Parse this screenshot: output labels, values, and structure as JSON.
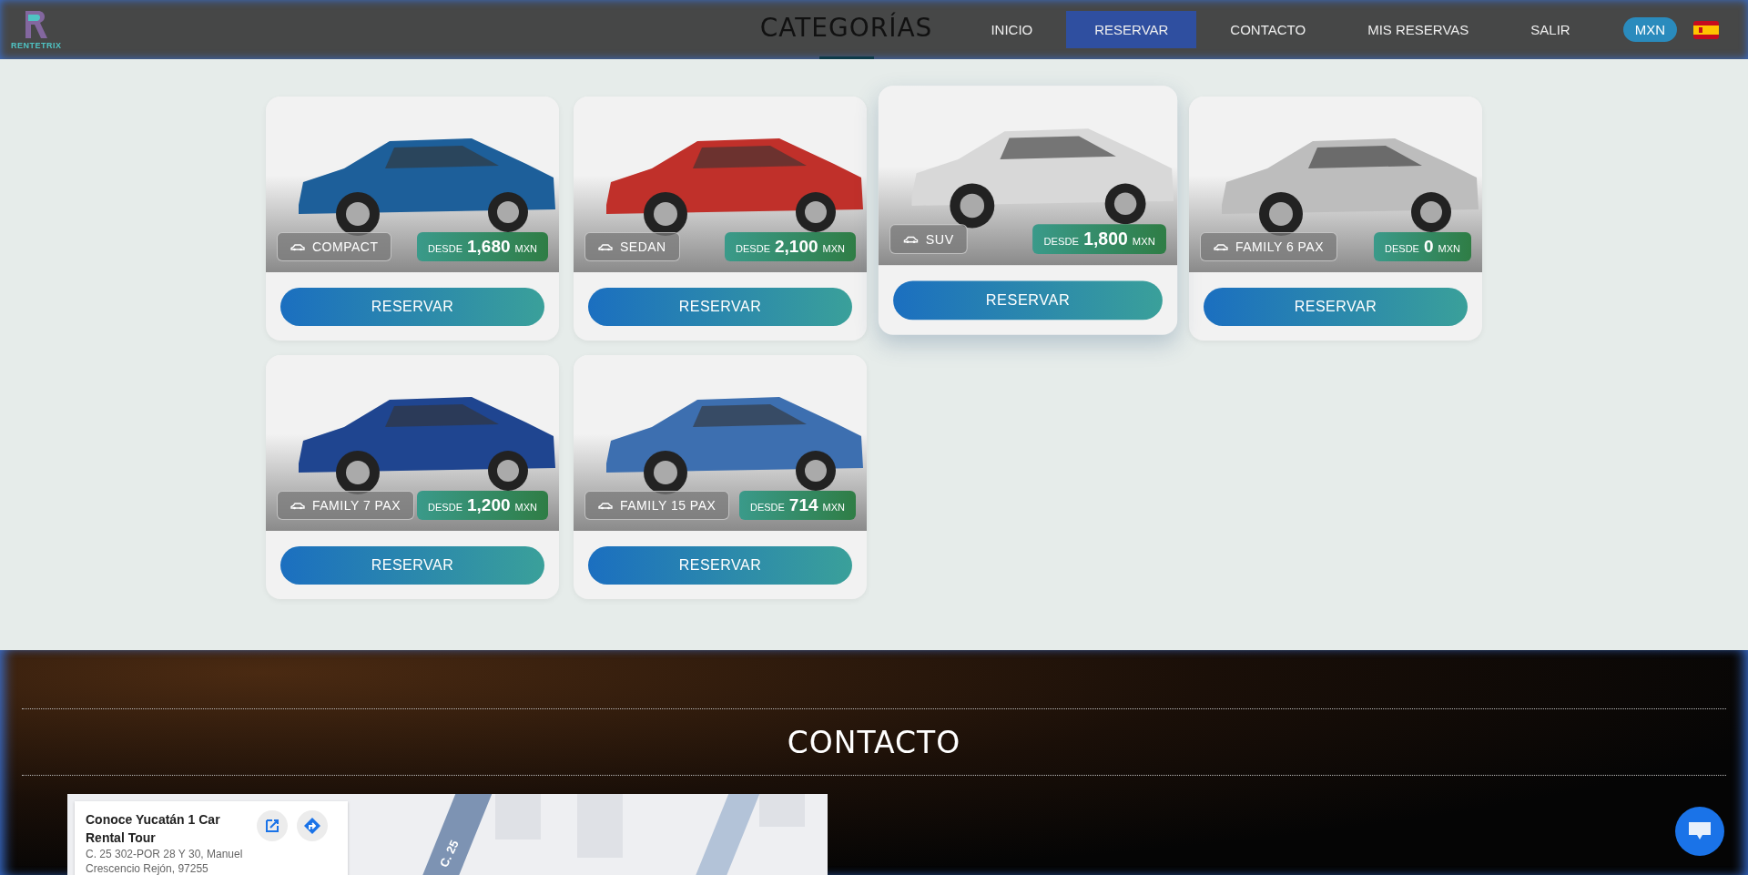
{
  "header": {
    "logo_text": "RENTETRIX",
    "page_title": "CATEGORÍAS",
    "nav": [
      {
        "label": "INICIO",
        "selected": false
      },
      {
        "label": "RESERVAR",
        "selected": true
      },
      {
        "label": "CONTACTO",
        "selected": false
      },
      {
        "label": "MIS RESERVAS",
        "selected": false
      },
      {
        "label": "SALIR",
        "selected": false
      }
    ],
    "currency": "MXN"
  },
  "cards": [
    {
      "name": "COMPACT",
      "price_prefix": "DESDE",
      "price": "1,680",
      "currency": "MXN",
      "button": "RESERVAR",
      "highlighted": false
    },
    {
      "name": "SEDAN",
      "price_prefix": "DESDE",
      "price": "2,100",
      "currency": "MXN",
      "button": "RESERVAR",
      "highlighted": false
    },
    {
      "name": "SUV",
      "price_prefix": "DESDE",
      "price": "1,800",
      "currency": "MXN",
      "button": "RESERVAR",
      "highlighted": true
    },
    {
      "name": "FAMILY 6 PAX",
      "price_prefix": "DESDE",
      "price": "0",
      "currency": "MXN",
      "button": "RESERVAR",
      "highlighted": false
    },
    {
      "name": "FAMILY 7 PAX",
      "price_prefix": "DESDE",
      "price": "1,200",
      "currency": "MXN",
      "button": "RESERVAR",
      "highlighted": false
    },
    {
      "name": "FAMILY 15 PAX",
      "price_prefix": "DESDE",
      "price": "714",
      "currency": "MXN",
      "button": "RESERVAR",
      "highlighted": false
    }
  ],
  "contact": {
    "title": "CONTACTO",
    "map": {
      "place_name": "Conoce Yucatán 1 Car Rental Tour",
      "address_lines": [
        "C. 25 302-POR 28 Y 30, Manuel",
        "Crescencio Rejón, 97255"
      ],
      "road_label": "C. 25"
    }
  }
}
